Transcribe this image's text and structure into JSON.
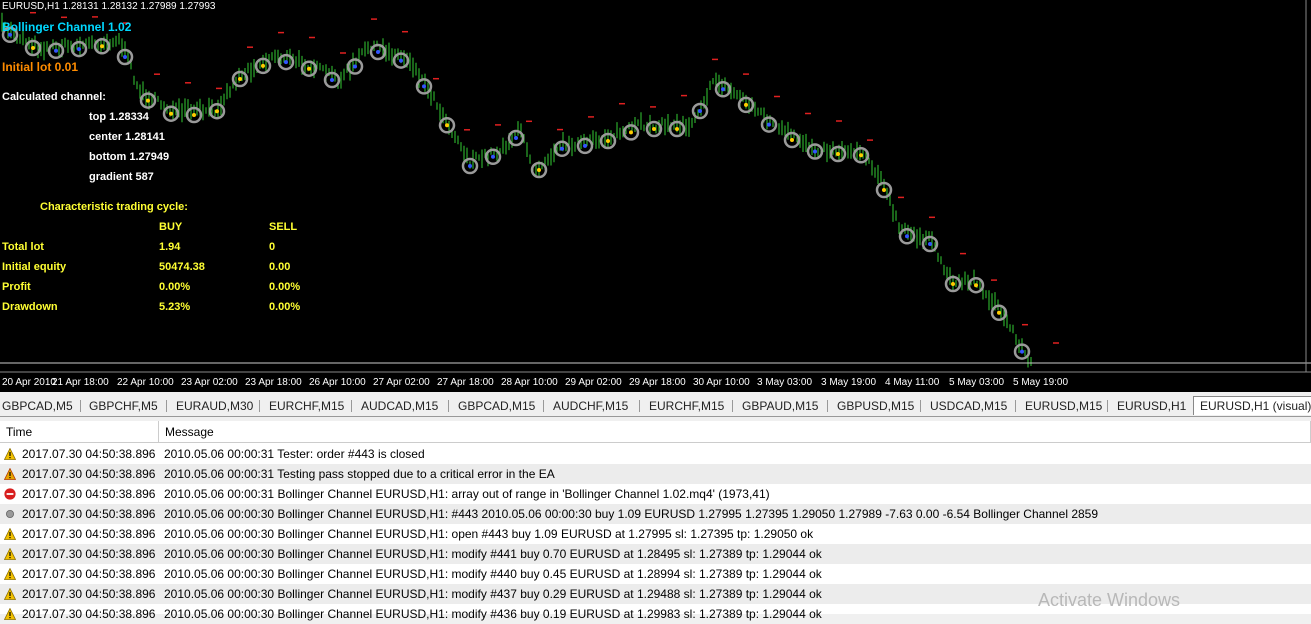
{
  "chart": {
    "symbol_line": "EURUSD,H1  1.28131 1.28132 1.27989 1.27993",
    "indicator_title": "Bollinger Channel 1.02",
    "initial_lot": "Initial lot 0.01",
    "calculated_channel": "Calculated channel:",
    "top": "top 1.28334",
    "center": "center 1.28141",
    "bottom": "bottom 1.27949",
    "gradient": "gradient 587",
    "cycle_header": "Characteristic trading cycle:",
    "buy_header": "BUY",
    "sell_header": "SELL",
    "stats": [
      {
        "label": "Total lot",
        "buy": "1.94",
        "sell": "0"
      },
      {
        "label": "Initial equity",
        "buy": "50474.38",
        "sell": "0.00"
      },
      {
        "label": "Profit",
        "buy": "0.00%",
        "sell": "0.00%"
      },
      {
        "label": "Drawdown",
        "buy": "5.23%",
        "sell": "0.00%"
      }
    ],
    "x_labels": [
      "20 Apr 2010",
      "21 Apr 18:00",
      "22 Apr 10:00",
      "23 Apr 02:00",
      "23 Apr 18:00",
      "26 Apr 10:00",
      "27 Apr 02:00",
      "27 Apr 18:00",
      "28 Apr 10:00",
      "29 Apr 02:00",
      "29 Apr 18:00",
      "30 Apr 10:00",
      "3 May 03:00",
      "3 May 19:00",
      "4 May 11:00",
      "5 May 03:00",
      "5 May 19:00"
    ],
    "colors": {
      "background": "#000000",
      "candles": "#33cc33",
      "title": "#00d8ff",
      "lot": "#ff8c00",
      "stats": "#ffff33"
    }
  },
  "tabs": [
    "GBPCAD,M5",
    "GBPCHF,M5",
    "EURAUD,M30",
    "EURCHF,M15",
    "AUDCAD,M15",
    "GBPCAD,M15",
    "AUDCHF,M15",
    "EURCHF,M15",
    "GBPAUD,M15",
    "GBPUSD,M15",
    "USDCAD,M15",
    "EURUSD,M15",
    "EURUSD,H1",
    "EURUSD,H1 (visual)"
  ],
  "journal": {
    "col_time": "Time",
    "col_message": "Message",
    "rows": [
      {
        "icon": "warning-icon",
        "time": "2017.07.30 04:50:38.896",
        "message": "2010.05.06 00:00:31  Tester: order #443 is closed"
      },
      {
        "icon": "warning-icon",
        "time": "2017.07.30 04:50:38.896",
        "message": "2010.05.06 00:00:31  Testing pass stopped due to a critical error in the EA"
      },
      {
        "icon": "error-icon",
        "time": "2017.07.30 04:50:38.896",
        "message": "2010.05.06 00:00:31  Bollinger Channel EURUSD,H1: array out of range in 'Bollinger Channel 1.02.mq4' (1973,41)"
      },
      {
        "icon": "info-icon",
        "time": "2017.07.30 04:50:38.896",
        "message": "2010.05.06 00:00:30  Bollinger Channel EURUSD,H1: #443 2010.05.06 00:00:30 buy 1.09 EURUSD 1.27995 1.27395 1.29050 1.27989 -7.63 0.00 -6.54 Bollinger Channel 2859"
      },
      {
        "icon": "warning-icon",
        "time": "2017.07.30 04:50:38.896",
        "message": "2010.05.06 00:00:30  Bollinger Channel EURUSD,H1: open #443 buy 1.09 EURUSD at 1.27995 sl: 1.27395 tp: 1.29050 ok"
      },
      {
        "icon": "warning-icon",
        "time": "2017.07.30 04:50:38.896",
        "message": "2010.05.06 00:00:30  Bollinger Channel EURUSD,H1: modify #441 buy 0.70 EURUSD at 1.28495 sl: 1.27389 tp: 1.29044 ok"
      },
      {
        "icon": "warning-icon",
        "time": "2017.07.30 04:50:38.896",
        "message": "2010.05.06 00:00:30  Bollinger Channel EURUSD,H1: modify #440 buy 0.45 EURUSD at 1.28994 sl: 1.27389 tp: 1.29044 ok"
      },
      {
        "icon": "warning-icon",
        "time": "2017.07.30 04:50:38.896",
        "message": "2010.05.06 00:00:30  Bollinger Channel EURUSD,H1: modify #437 buy 0.29 EURUSD at 1.29488 sl: 1.27389 tp: 1.29044 ok"
      },
      {
        "icon": "warning-icon",
        "time": "2017.07.30 04:50:38.896",
        "message": "2010.05.06 00:00:30  Bollinger Channel EURUSD,H1: modify #436 buy 0.19 EURUSD at 1.29983 sl: 1.27389 tp: 1.29044 ok"
      }
    ]
  },
  "watermark": "Activate Windows"
}
